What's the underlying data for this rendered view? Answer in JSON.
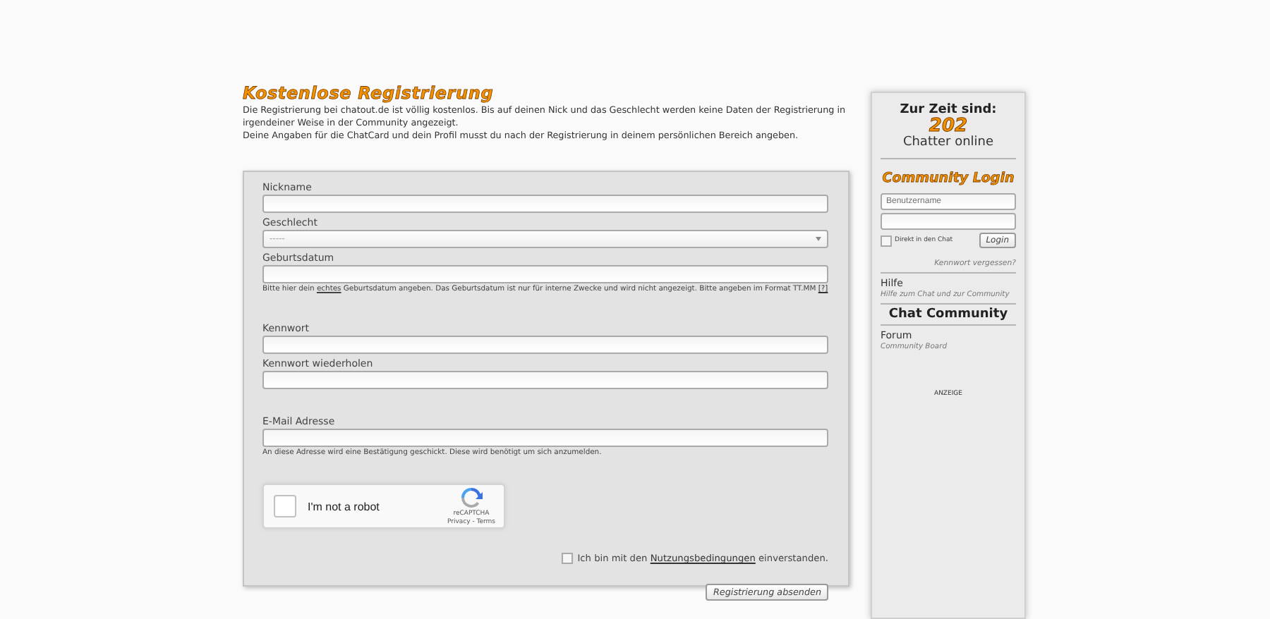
{
  "main": {
    "title": "Kostenlose Registrierung",
    "intro": [
      "Die Registrierung bei chatout.de ist völlig kostenlos. Bis auf deinen Nick und das Geschlecht werden keine Daten der Registrierung in irgendeiner Weise in der Community angezeigt.",
      "Deine Angaben für die ChatCard und dein Profil musst du nach der Registrierung in deinem persönlichen Bereich angeben."
    ],
    "field_groups": [
      [
        {
          "kind": "text",
          "label": "Nickname"
        },
        {
          "kind": "select",
          "label": "Geschlecht",
          "value": "-----"
        },
        {
          "kind": "text",
          "label": "Geburtsdatum",
          "hint": {
            "before": "Bitte hier dein",
            "underlined": "echtes",
            "after": "Geburtsdatum angeben. Das Geburtsdatum ist nur für interne Zwecke und wird nicht angezeigt. Bitte angeben im Format TT.MM",
            "link": "[?]"
          }
        }
      ],
      [
        {
          "kind": "text",
          "label": "Kennwort"
        },
        {
          "kind": "text",
          "label": "Kennwort wiederholen"
        }
      ],
      [
        {
          "kind": "text",
          "label": "E-Mail Adresse",
          "hint": {
            "before": "An diese Adresse wird eine Bestätigung geschickt. Diese wird benötigt um sich anzumelden."
          }
        }
      ]
    ],
    "captcha": {
      "label": "I'm not a robot",
      "checked": false,
      "brand": "reCAPTCHA",
      "links": "Privacy - Terms"
    },
    "terms": {
      "checked": false,
      "before": "Ich bin mit den",
      "link": "Nutzungsbedingungen",
      "after": "einverstanden."
    },
    "submit": "Registrierung absenden"
  },
  "sidebar": {
    "online_heading": "Zur Zeit sind:",
    "online_count": "202",
    "online_label": "Chatter online",
    "login_title": "Community Login",
    "username_placeholder": "Benutzername",
    "direct_chat": {
      "label": "Direkt in den Chat",
      "checked": false
    },
    "login_button": "Login",
    "forgot": "Kennwort vergessen?",
    "help": {
      "title": "Hilfe",
      "subtitle": "Hilfe zum Chat und zur Community"
    },
    "community_heading": "Chat Community",
    "forum": {
      "title": "Forum",
      "subtitle": "Community Board"
    },
    "ad_label": "ANZEIGE"
  }
}
